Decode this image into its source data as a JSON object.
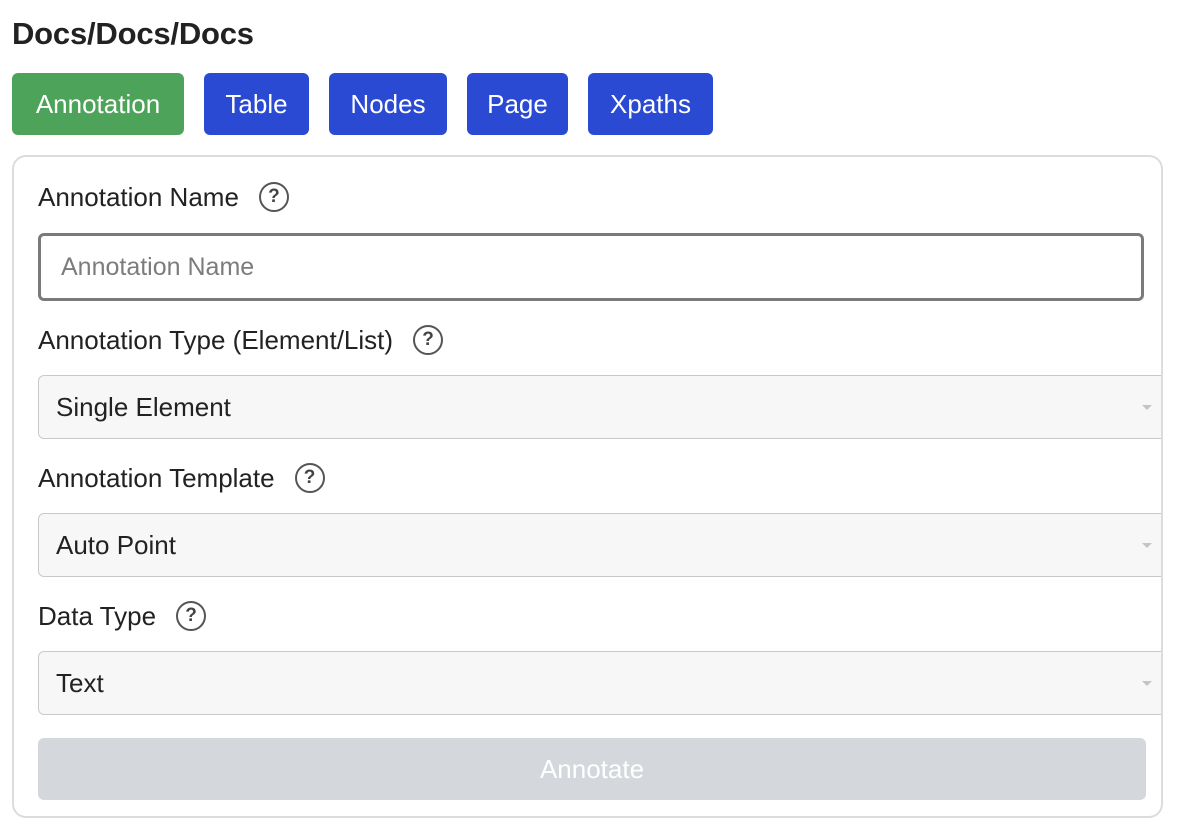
{
  "breadcrumb": "Docs/Docs/Docs",
  "tabs": [
    {
      "label": "Annotation",
      "active": true
    },
    {
      "label": "Table",
      "active": false
    },
    {
      "label": "Nodes",
      "active": false
    },
    {
      "label": "Page",
      "active": false
    },
    {
      "label": "Xpaths",
      "active": false
    }
  ],
  "form": {
    "name_label": "Annotation Name",
    "name_placeholder": "Annotation Name",
    "name_value": "",
    "type_label": "Annotation Type (Element/List)",
    "type_value": "Single Element",
    "template_label": "Annotation Template",
    "template_value": "Auto Point",
    "datatype_label": "Data Type",
    "datatype_value": "Text",
    "help_glyph": "?",
    "submit_label": "Annotate"
  },
  "colors": {
    "tab_active": "#4ea35a",
    "tab_inactive": "#2a4ad4",
    "button_disabled": "#d4d7db"
  },
  "icons": {
    "help": "question-circle-icon",
    "dropdown": "caret-down-icon"
  }
}
